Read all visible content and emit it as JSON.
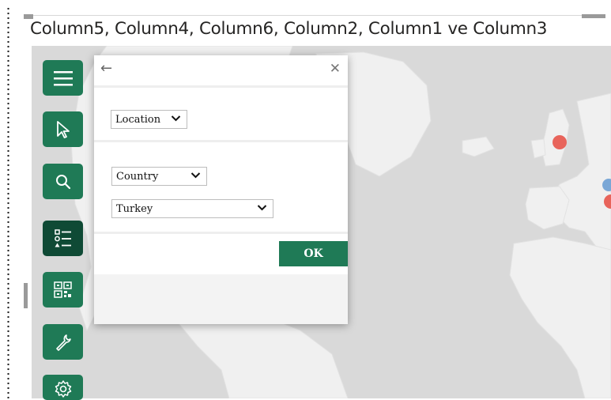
{
  "visual": {
    "title": "Column5, Column4, Column6, Column2, Column1 ve Column3"
  },
  "toolbar": {
    "buttons": [
      {
        "icon": "hamburger-menu-icon"
      },
      {
        "icon": "pointer-select-icon"
      },
      {
        "icon": "search-icon"
      },
      {
        "icon": "layer-list-icon",
        "active": true
      },
      {
        "icon": "qr-grid-icon"
      },
      {
        "icon": "wrench-icon"
      },
      {
        "icon": "gear-icon"
      }
    ]
  },
  "dialog": {
    "back_glyph": "←",
    "close_glyph": "✕",
    "location_select": {
      "value": "Location"
    },
    "field_select": {
      "value": "Country"
    },
    "value_select": {
      "value": "Turkey"
    },
    "ok_label": "OK"
  },
  "colors": {
    "accent": "#1f7a56",
    "accent_active": "#0f4a35",
    "map_water": "#d9d9d9",
    "map_land": "#f0f0f0",
    "marker_red": "#e8645b",
    "marker_blue": "#7aa7d6"
  }
}
